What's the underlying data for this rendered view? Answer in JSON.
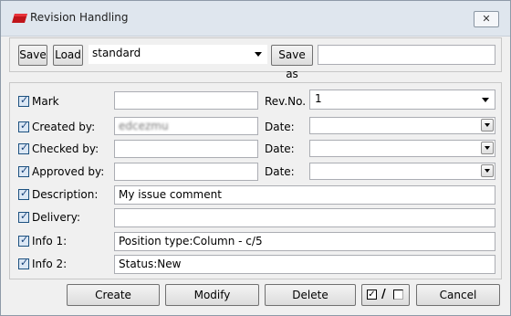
{
  "window": {
    "title": "Revision Handling",
    "close_glyph": "✕"
  },
  "toolbar": {
    "save_label": "Save",
    "load_label": "Load",
    "preset_value": "standard",
    "save_as_label": "Save as",
    "save_as_value": ""
  },
  "form": {
    "mark": {
      "label": "Mark",
      "value": ""
    },
    "rev_no": {
      "label": "Rev.No.",
      "value": "1"
    },
    "created_by": {
      "label": "Created by:",
      "value": "edcezmu",
      "date_label": "Date:",
      "date_value": ""
    },
    "checked_by": {
      "label": "Checked by:",
      "value": "",
      "date_label": "Date:",
      "date_value": ""
    },
    "approved_by": {
      "label": "Approved by:",
      "value": "",
      "date_label": "Date:",
      "date_value": ""
    },
    "description": {
      "label": "Description:",
      "value": "My issue comment"
    },
    "delivery": {
      "label": "Delivery:",
      "value": ""
    },
    "info1": {
      "label": "Info 1:",
      "value": "Position type:Column - c/5"
    },
    "info2": {
      "label": "Info 2:",
      "value": "Status:New"
    }
  },
  "footer": {
    "create_label": "Create",
    "modify_label": "Modify",
    "delete_label": "Delete",
    "cancel_label": "Cancel",
    "toggle_separator": "/"
  }
}
